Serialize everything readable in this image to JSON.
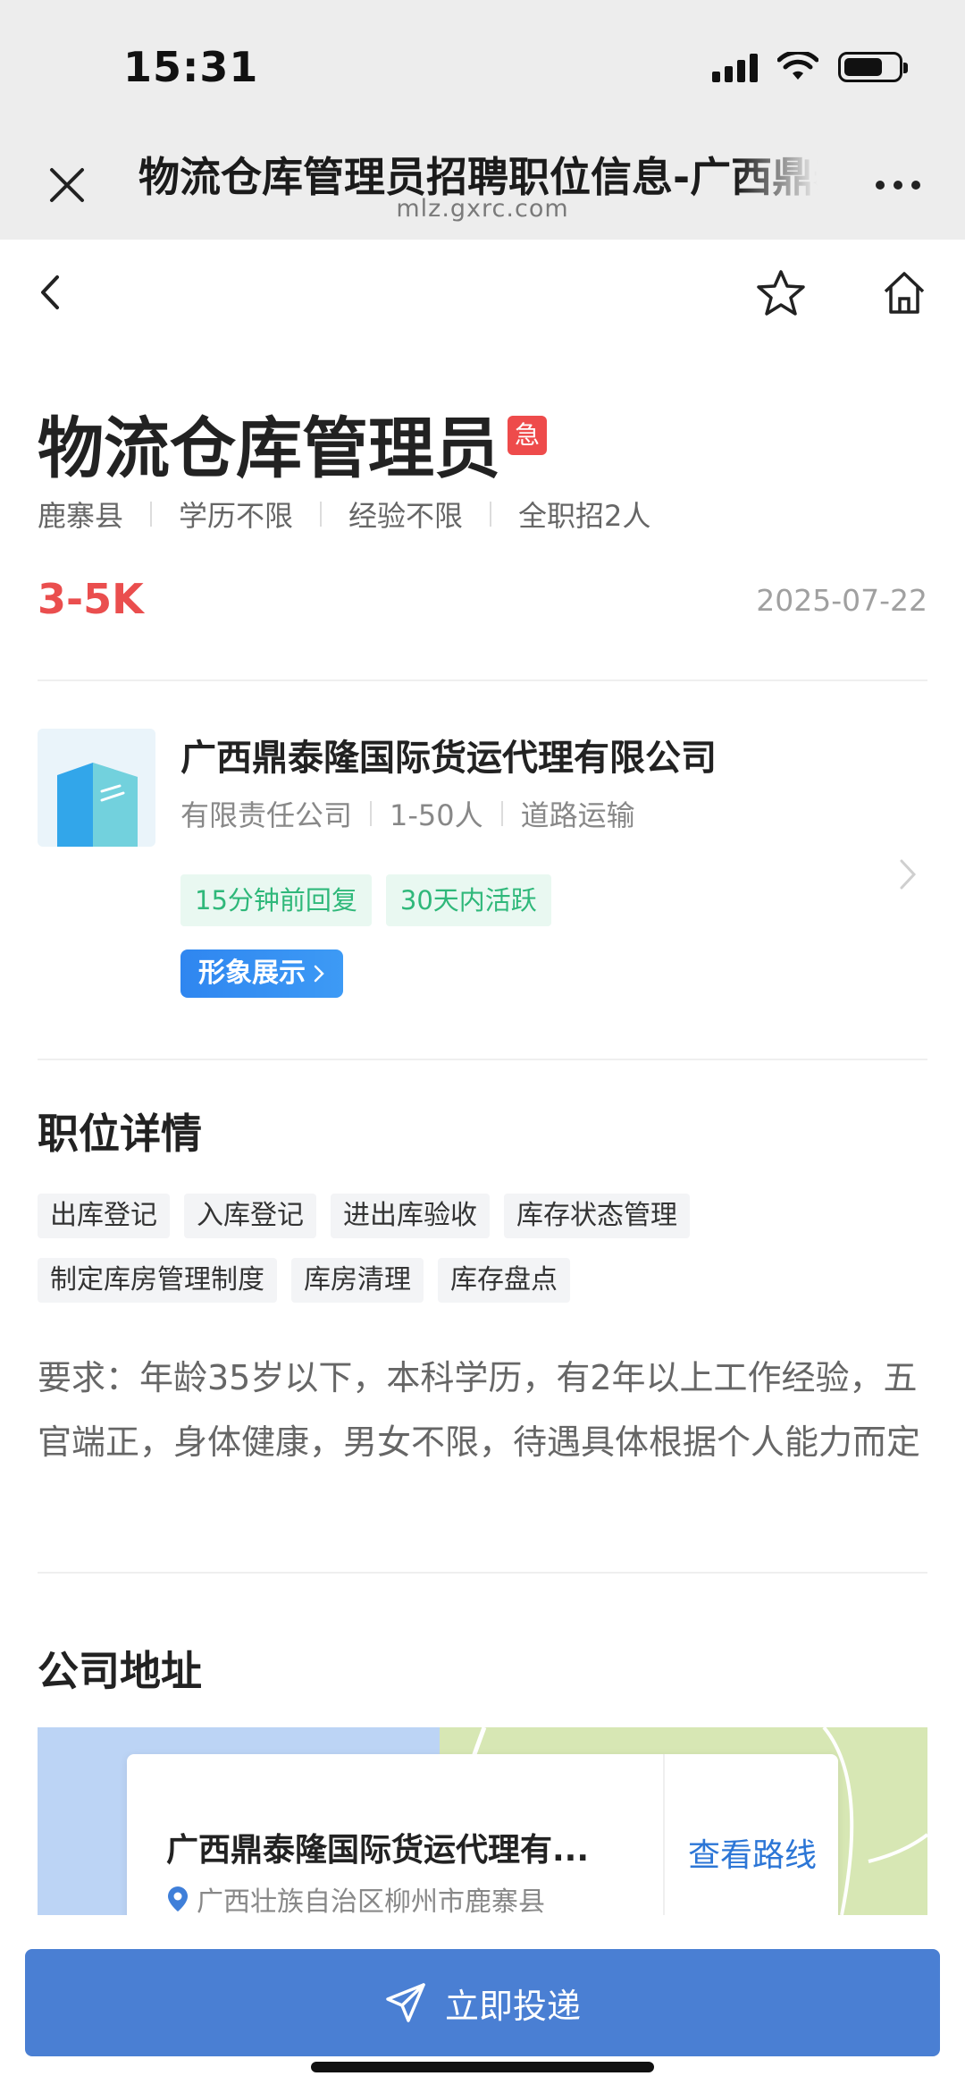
{
  "status_bar": {
    "time": "15:31"
  },
  "browser": {
    "title": "物流仓库管理员招聘职位信息-广西鼎泰隆国际货运代理有限公司",
    "url": "mlz.gxrc.com"
  },
  "job": {
    "title": "物流仓库管理员",
    "urgent_badge": "急",
    "meta": [
      "鹿寨县",
      "学历不限",
      "经验不限",
      "全职招2人"
    ],
    "salary": "3-5K",
    "date": "2025-07-22"
  },
  "company": {
    "name": "广西鼎泰隆国际货运代理有限公司",
    "meta": [
      "有限责任公司",
      "1-50人",
      "道路运输"
    ],
    "activity_tags": [
      "15分钟前回复",
      "30天内活跃"
    ],
    "showcase_label": "形象展示"
  },
  "details": {
    "section_title": "职位详情",
    "skills": [
      "出库登记",
      "入库登记",
      "进出库验收",
      "库存状态管理",
      "制定库房管理制度",
      "库房清理",
      "库存盘点"
    ],
    "description": "要求：年龄35岁以下，本科学历，有2年以上工作经验，五官端正，身体健康，男女不限，待遇具体根据个人能力而定"
  },
  "address": {
    "section_title": "公司地址",
    "company_name": "广西鼎泰隆国际货运代理有...",
    "location": "广西壮族自治区柳州市鹿寨县",
    "route_label": "查看路线"
  },
  "footer": {
    "apply_label": "立即投递"
  },
  "colors": {
    "accent_blue": "#4a7fd3",
    "salary_red": "#ea4e4e",
    "active_green": "#2fb87a"
  }
}
